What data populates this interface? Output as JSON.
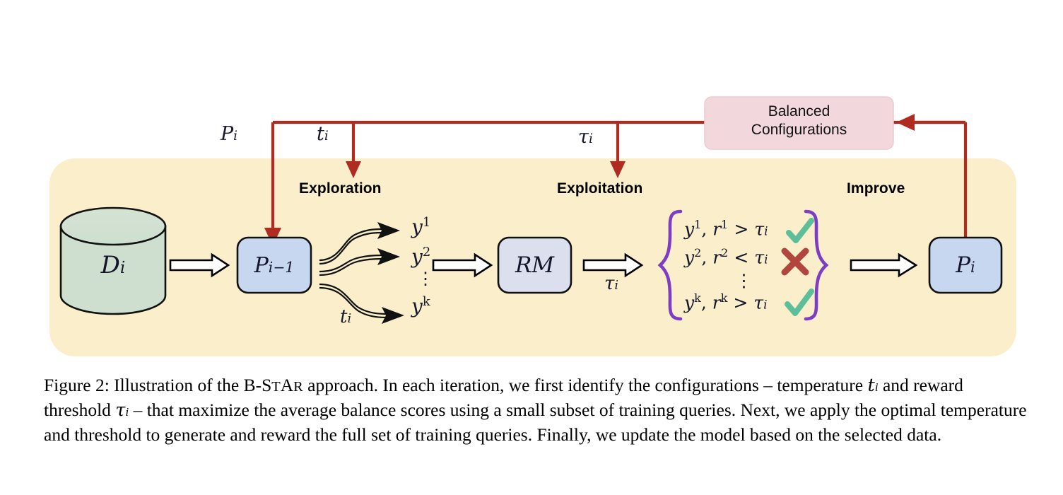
{
  "figure": {
    "panel_color": "#faeecb",
    "feedback_box": {
      "label_line1": "Balanced",
      "label_line2": "Configurations",
      "fill": "#f2d7dc",
      "border": "#e8c3ca"
    },
    "arrow_color": "#b02b20",
    "stages": [
      {
        "id": "exploration",
        "label": "Exploration"
      },
      {
        "id": "exploitation",
        "label": "Exploitation"
      },
      {
        "id": "improve",
        "label": "Improve"
      }
    ],
    "feedback_labels": [
      {
        "id": "policy-out",
        "base": "P",
        "sub": "i"
      },
      {
        "id": "temperature",
        "base": "t",
        "sub": "i"
      },
      {
        "id": "threshold",
        "base": "τ",
        "sub": "i"
      }
    ],
    "nodes": {
      "dataset": {
        "base": "D",
        "sub": "i",
        "fill": "#cfdfcf",
        "shape": "cylinder"
      },
      "policy_prev": {
        "base": "P",
        "sub": "i−1",
        "fill": "#c7d7f0",
        "shape": "rounded-rect"
      },
      "reward_model": {
        "base": "RM",
        "sub": "",
        "fill": "#dbdfee",
        "shape": "rounded-rect"
      },
      "policy_new": {
        "base": "P",
        "sub": "i",
        "fill": "#c7d7f0",
        "shape": "rounded-rect"
      }
    },
    "generations": {
      "items": [
        {
          "base": "y",
          "sup": "1"
        },
        {
          "base": "y",
          "sup": "2"
        },
        {
          "base": "y",
          "sup": "k"
        }
      ],
      "ellipsis": "⋮",
      "temperature_label": {
        "base": "t",
        "sub": "i"
      }
    },
    "threshold_under_arrow": {
      "base": "τ",
      "sub": "i"
    },
    "selection": {
      "brace_color": "#7d3ec4",
      "check_color": "#5cbf9a",
      "cross_color": "#b3453f",
      "ellipsis": "⋮",
      "rows": [
        {
          "y_base": "y",
          "y_sup": "1",
          "r_base": "r",
          "r_sup": "1",
          "op": ">",
          "tau": "τ",
          "tau_sub": "i",
          "mark": "check"
        },
        {
          "y_base": "y",
          "y_sup": "2",
          "r_base": "r",
          "r_sup": "2",
          "op": "<",
          "tau": "τ",
          "tau_sub": "i",
          "mark": "cross"
        },
        {
          "y_base": "y",
          "y_sup": "k",
          "r_base": "r",
          "r_sup": "k",
          "op": ">",
          "tau": "τ",
          "tau_sub": "i",
          "mark": "check"
        }
      ]
    }
  },
  "caption": {
    "figure_number": "Figure 2:",
    "text_1": " Illustration of the B-S",
    "smallcaps_1": "T",
    "text_2": "A",
    "smallcaps_2": "R",
    "text_3": " approach.  In each iteration, we first identify the configurations – temperature ",
    "math_t": "t",
    "math_t_sub": "i",
    "text_4": " and reward threshold ",
    "math_tau": "τ",
    "math_tau_sub": "i",
    "text_5": " – that maximize the average balance scores using a small subset of training queries. Next, we apply the optimal temperature and threshold to generate and reward the full set of training queries. Finally, we update the model based on the selected data."
  }
}
